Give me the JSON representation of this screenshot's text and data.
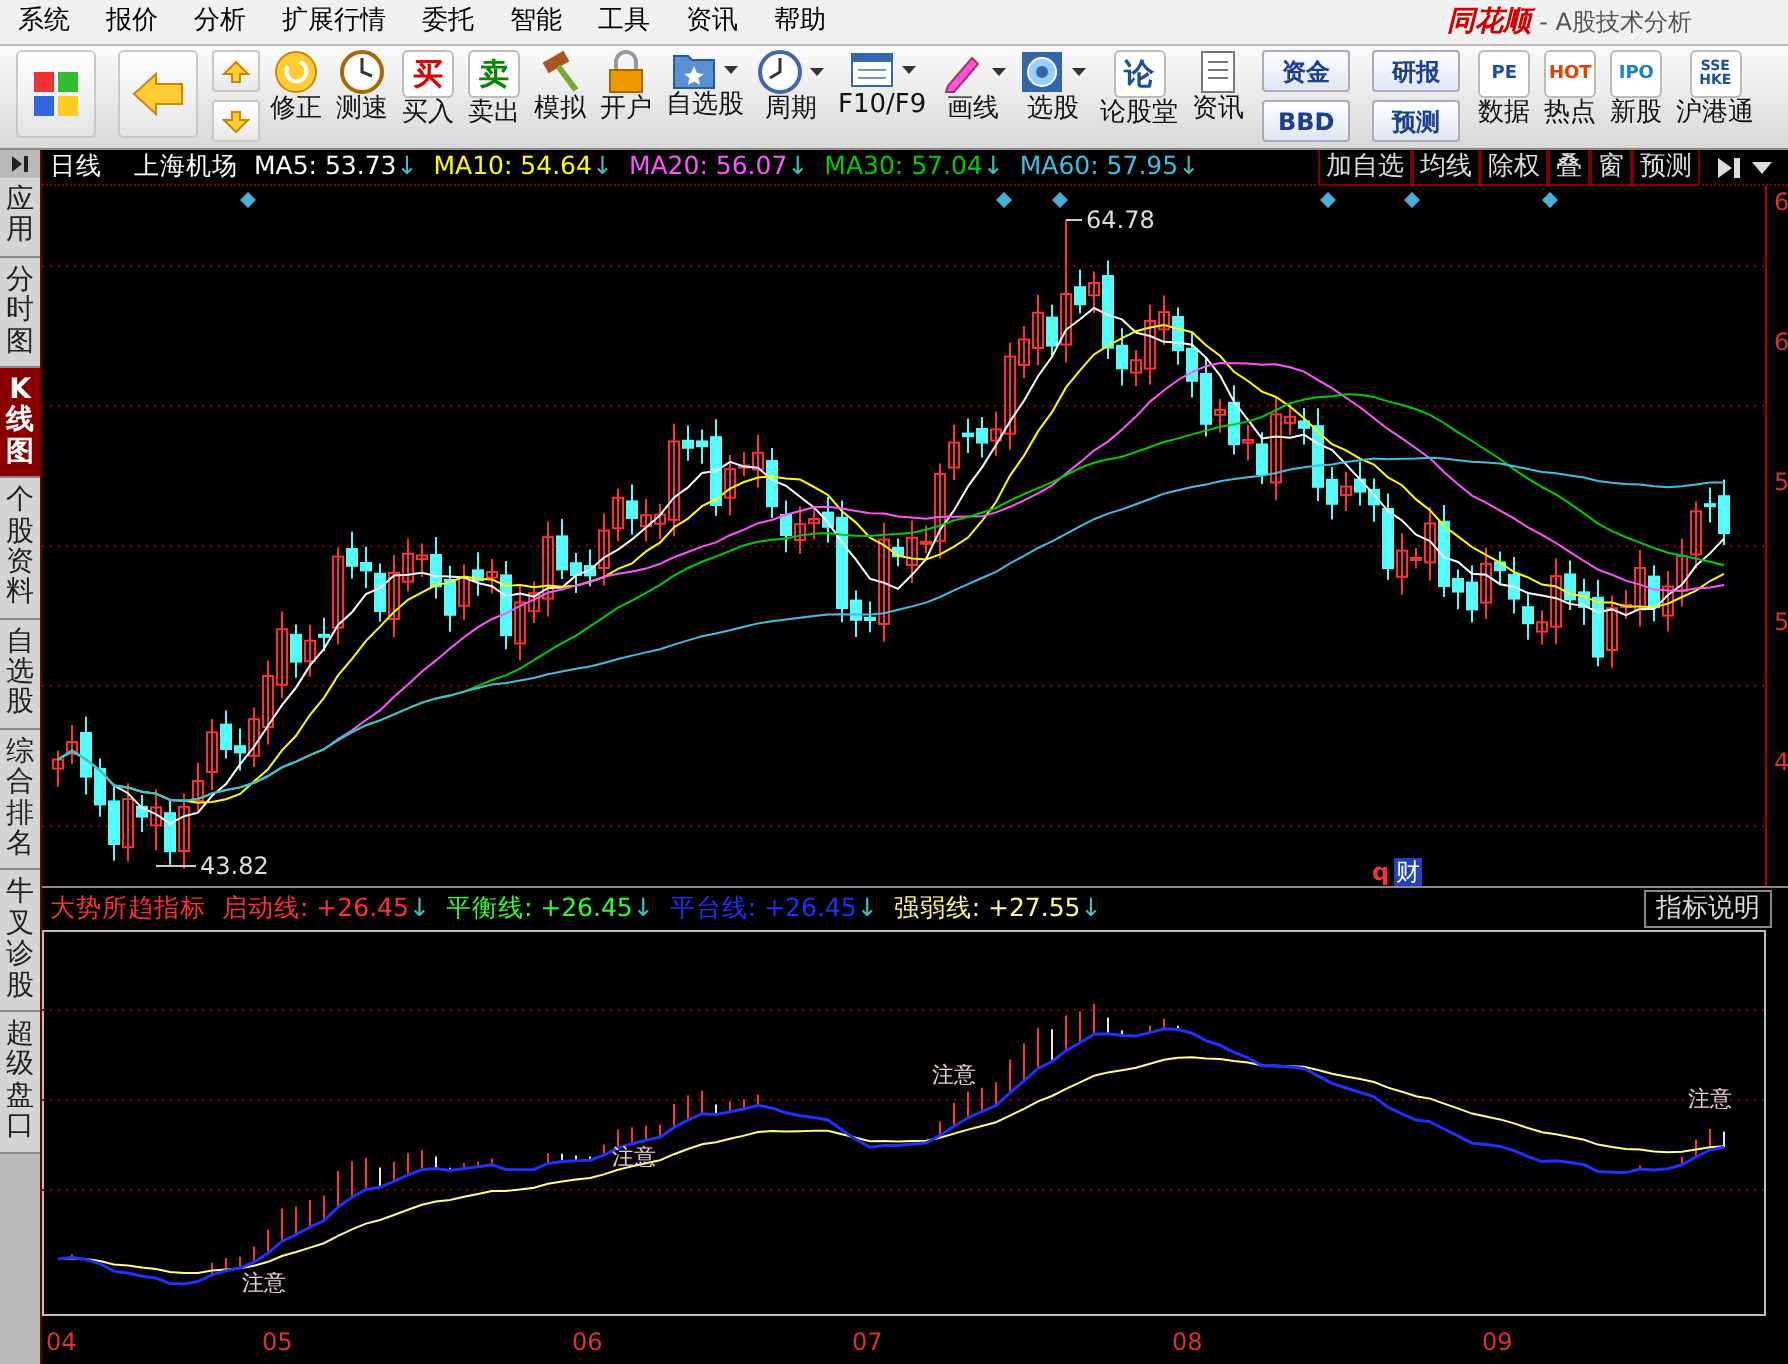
{
  "menu": [
    {
      "label": "系统"
    },
    {
      "label": "报价"
    },
    {
      "label": "分析"
    },
    {
      "label": "扩展行情"
    },
    {
      "label": "委托"
    },
    {
      "label": "智能"
    },
    {
      "label": "工具"
    },
    {
      "label": "资讯"
    },
    {
      "label": "帮助"
    }
  ],
  "app_title": {
    "brand": "同花顺",
    "subtitle": "- A股技术分析"
  },
  "toolbar": [
    {
      "kind": "tiles"
    },
    {
      "kind": "back"
    },
    {
      "kind": "updown"
    },
    {
      "kind": "refresh",
      "label": "修正"
    },
    {
      "kind": "clock",
      "label": "测速"
    },
    {
      "kind": "glyph",
      "glyph": "买",
      "color": "#e00000",
      "label": "买入"
    },
    {
      "kind": "glyph",
      "glyph": "卖",
      "color": "#008800",
      "label": "卖出"
    },
    {
      "kind": "hammer",
      "label": "模拟"
    },
    {
      "kind": "lock",
      "label": "开户"
    },
    {
      "kind": "star-folder",
      "label": "自选股",
      "dropdown": true
    },
    {
      "kind": "period",
      "label": "周期",
      "dropdown": true
    },
    {
      "kind": "window",
      "label": "F10/F9",
      "dropdown": true
    },
    {
      "kind": "pencil",
      "label": "画线",
      "dropdown": true
    },
    {
      "kind": "globe",
      "label": "选股",
      "dropdown": true
    },
    {
      "kind": "glyph",
      "glyph": "论",
      "color": "#1a4fa0",
      "label": "论股堂"
    },
    {
      "kind": "document",
      "label": "资讯"
    },
    {
      "kind": "stack",
      "labels": [
        "资金",
        "BBD"
      ]
    },
    {
      "kind": "stack",
      "labels": [
        "研报",
        "预测"
      ]
    },
    {
      "kind": "glyph",
      "glyph": "PE",
      "color": "#1a4fa0",
      "label": "数据"
    },
    {
      "kind": "glyph",
      "glyph": "HOT",
      "color": "#e04000",
      "label": "热点"
    },
    {
      "kind": "glyph",
      "glyph": "IPO",
      "color": "#1a7fd0",
      "label": "新股"
    },
    {
      "kind": "glyph",
      "glyph": "SSE HKE",
      "color": "#1a4fa0",
      "label": "沪港通"
    }
  ],
  "side_tabs": [
    {
      "label": "应用",
      "selected": false
    },
    {
      "label": "分时图",
      "selected": false
    },
    {
      "label": "K线图",
      "selected": true
    },
    {
      "label": "个股资料",
      "selected": false
    },
    {
      "label": "自选股",
      "selected": false
    },
    {
      "label": "综合排名",
      "selected": false
    },
    {
      "label": "牛叉诊股",
      "selected": false
    },
    {
      "label": "超级盘口",
      "selected": false
    }
  ],
  "chart": {
    "period": "日线",
    "stock": "上海机场",
    "moving_averages": [
      {
        "label": "MA5: 53.73",
        "arrow": "↓",
        "color": "#ffffff"
      },
      {
        "label": "MA10: 54.64",
        "arrow": "↓",
        "color": "#ffff00"
      },
      {
        "label": "MA20: 56.07",
        "arrow": "↓",
        "color": "#ff55ff"
      },
      {
        "label": "MA30: 57.04",
        "arrow": "↓",
        "color": "#00cc00"
      },
      {
        "label": "MA60: 57.95",
        "arrow": "↓",
        "color": "#40c0e0"
      }
    ],
    "buttons": [
      "加自选",
      "均线",
      "除权",
      "叠",
      "窗",
      "预测"
    ],
    "high_label": "64.78",
    "low_label": "43.82",
    "y_axis_labels": [
      "6",
      "6",
      "5",
      "5",
      "4"
    ],
    "finance_marker": {
      "letter": "q",
      "badge": "财"
    }
  },
  "indicator": {
    "name": "大势所趋指标",
    "lines": [
      {
        "label": "启动线: +26.45",
        "arrow": "↓",
        "color": "#ff3030"
      },
      {
        "label": "平衡线: +26.45",
        "arrow": "↓",
        "color": "#30ff30"
      },
      {
        "label": "平台线: +26.45",
        "arrow": "↓",
        "color": "#2030ff"
      },
      {
        "label": "强弱线: +27.55",
        "arrow": "↓",
        "color": "#ffff80"
      }
    ],
    "button": "指标说明",
    "notes": [
      "注意",
      "注意",
      "注意",
      "注意"
    ]
  },
  "x_axis": [
    "04",
    "05",
    "06",
    "07",
    "08",
    "09"
  ]
}
